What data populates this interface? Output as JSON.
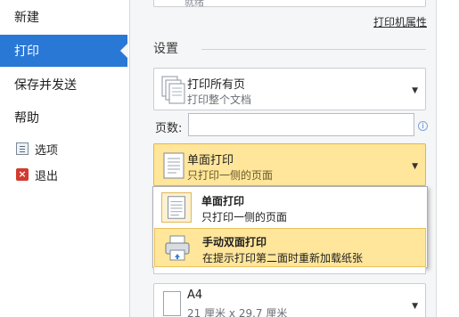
{
  "nav": {
    "new": "新建",
    "print": "打印",
    "save_send": "保存并发送",
    "help": "帮助",
    "options": "选项",
    "exit": "退出"
  },
  "printer": {
    "top_box_text": "就绪",
    "properties_link": "打印机属性"
  },
  "settings": {
    "title": "设置",
    "print_range": {
      "title": "打印所有页",
      "subtitle": "打印整个文档"
    },
    "pages_label": "页数:",
    "pages_value": "",
    "sides": {
      "title": "单面打印",
      "subtitle": "只打印一侧的页面"
    },
    "sides_options": [
      {
        "title": "单面打印",
        "subtitle": "只打印一侧的页面"
      },
      {
        "title": "手动双面打印",
        "subtitle": "在提示打印第二面时重新加载纸张"
      }
    ],
    "paper": {
      "title": "A4",
      "subtitle": "21 厘米 x 29.7 厘米"
    }
  },
  "colors": {
    "nav_active": "#2a78d6",
    "highlight": "#ffe69a",
    "highlight_border": "#e8b34a"
  }
}
